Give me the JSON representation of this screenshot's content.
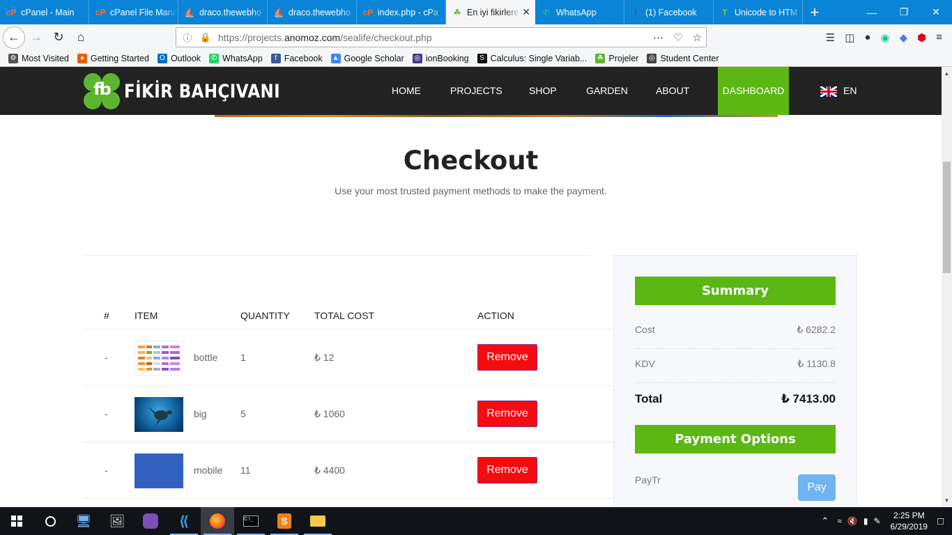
{
  "browser": {
    "tabs": [
      {
        "label": "cPanel - Main",
        "icon": "cpanel-icon",
        "color": "#ff6c2c"
      },
      {
        "label": "cPanel File Mana",
        "icon": "cpanel-icon",
        "color": "#ff6c2c"
      },
      {
        "label": "draco.thewebho",
        "icon": "sailboat-icon",
        "color": "#e58b2a"
      },
      {
        "label": "draco.thewebho",
        "icon": "sailboat-icon",
        "color": "#e58b2a"
      },
      {
        "label": "index.php - cPa",
        "icon": "cpanel-icon",
        "color": "#ff6c2c"
      },
      {
        "label": "En iyi fikirlere",
        "icon": "clover-icon",
        "color": "#5cb531",
        "active": true
      },
      {
        "label": "WhatsApp",
        "icon": "whatsapp-icon",
        "color": "#25d366"
      },
      {
        "label": "(1) Facebook",
        "icon": "facebook-icon",
        "color": "#3b5998"
      },
      {
        "label": "Unicode to HTM",
        "icon": "t-icon",
        "color": "#7ac943"
      }
    ],
    "url_prefix": "https://projects.",
    "url_domain": "anomoz.com",
    "url_path": "/sealife/checkout.php",
    "bookmarks": [
      {
        "label": "Most Visited",
        "icon": "gear-icon",
        "color": "#555"
      },
      {
        "label": "Getting Started",
        "icon": "firefox-icon",
        "color": "#e66000"
      },
      {
        "label": "Outlook",
        "icon": "outlook-icon",
        "color": "#0072c6"
      },
      {
        "label": "WhatsApp",
        "icon": "whatsapp-icon",
        "color": "#25d366"
      },
      {
        "label": "Facebook",
        "icon": "facebook-icon",
        "color": "#3b5998"
      },
      {
        "label": "Google Scholar",
        "icon": "scholar-icon",
        "color": "#4285f4"
      },
      {
        "label": "ionBooking",
        "icon": "ionbooking-icon",
        "color": "#4a3a8a"
      },
      {
        "label": "Calculus: Single Variab...",
        "icon": "coursera-icon",
        "color": "#111"
      },
      {
        "label": "Projeler",
        "icon": "clover-icon",
        "color": "#5cb531"
      },
      {
        "label": "Student Center",
        "icon": "globe-icon",
        "color": "#444"
      }
    ]
  },
  "site": {
    "logo_text": "FİKİR BAHÇIVANI",
    "logo_mark": "fb",
    "menu": [
      "HOME",
      "PROJECTS",
      "SHOP",
      "GARDEN",
      "ABOUT",
      "DASHBOARD"
    ],
    "lang": "EN",
    "accent": "#5cb714"
  },
  "checkout": {
    "title": "Checkout",
    "subtitle": "Use your most trusted payment methods to make the payment.",
    "columns": [
      "#",
      "ITEM",
      "QUANTITY",
      "TOTAL COST",
      "ACTION"
    ],
    "rows": [
      {
        "num": "-",
        "item": "bottle",
        "qty": "1",
        "cost": "₺ 12",
        "action": "Remove"
      },
      {
        "num": "-",
        "item": "big",
        "qty": "5",
        "cost": "₺ 1060",
        "action": "Remove"
      },
      {
        "num": "-",
        "item": "mobile",
        "qty": "11",
        "cost": "₺ 4400",
        "action": "Remove"
      }
    ]
  },
  "summary": {
    "title": "Summary",
    "cost_label": "Cost",
    "cost_value": "₺ 6282.2",
    "kdv_label": "KDV",
    "kdv_value": "₺ 1130.8",
    "total_label": "Total",
    "total_value": "₺ 7413.00",
    "payment_title": "Payment Options",
    "paytr_label": "PayTr",
    "pay_button": "Pay"
  },
  "taskbar": {
    "time": "2:25 PM",
    "date": "6/29/2019"
  }
}
